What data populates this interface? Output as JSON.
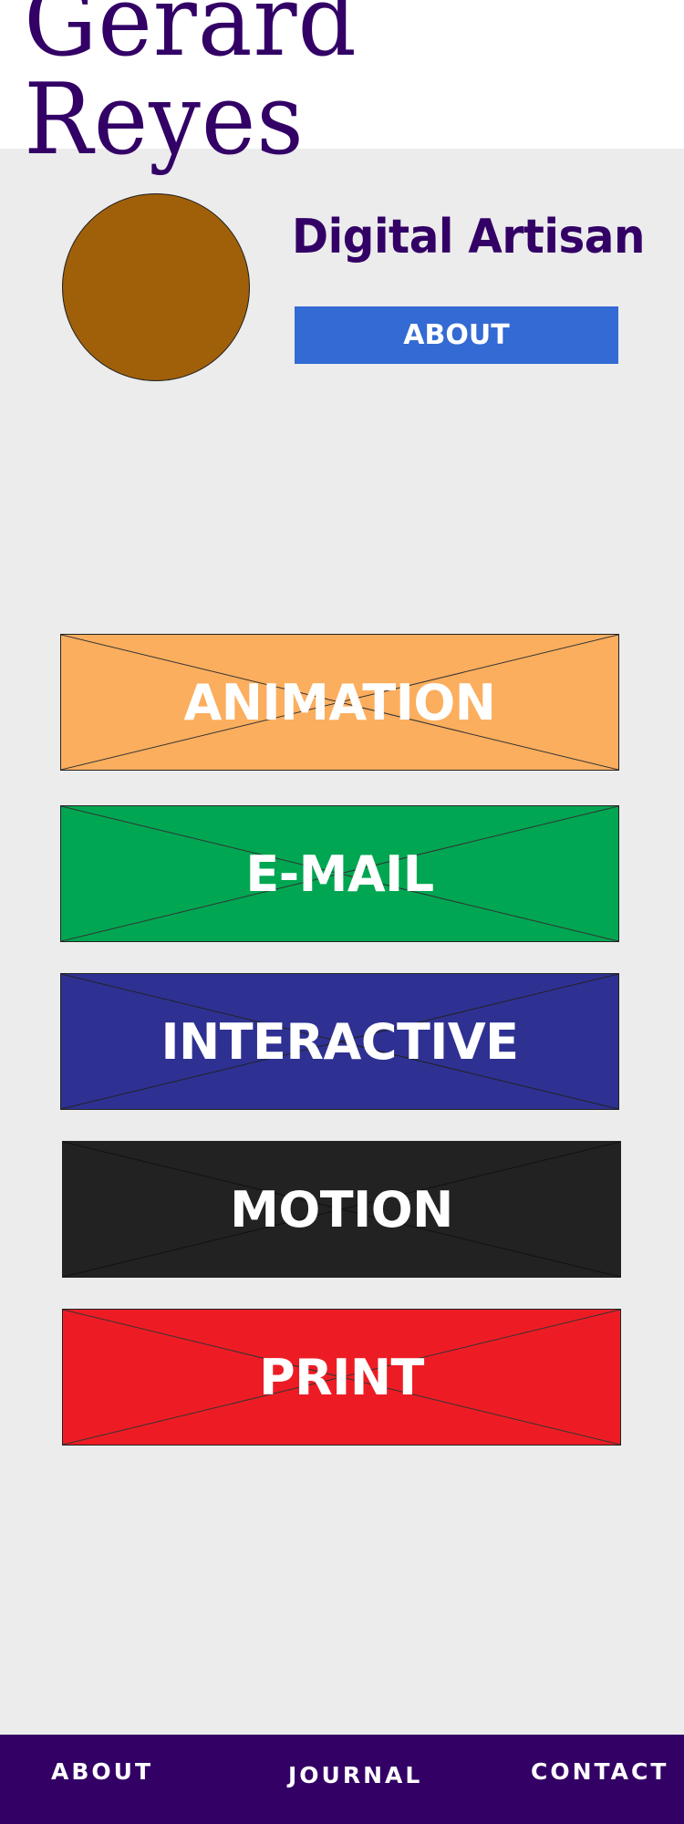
{
  "header": {
    "logo_text": "Gerard Reyes"
  },
  "profile": {
    "tagline": "Digital Artisan",
    "about_button": "ABOUT",
    "avatar_color": "#a0600a"
  },
  "categories": [
    {
      "label": "ANIMATION",
      "color": "#fbae5e"
    },
    {
      "label": "E-MAIL",
      "color": "#00a651"
    },
    {
      "label": "INTERACTIVE",
      "color": "#2e3192"
    },
    {
      "label": "MOTION",
      "color": "#222222"
    },
    {
      "label": "PRINT",
      "color": "#ed1c24"
    }
  ],
  "footer": {
    "links": [
      "ABOUT",
      "JOURNAL",
      "CONTACT"
    ]
  },
  "colors": {
    "brand": "#330066",
    "button": "#336ad3",
    "background": "#ececec"
  }
}
